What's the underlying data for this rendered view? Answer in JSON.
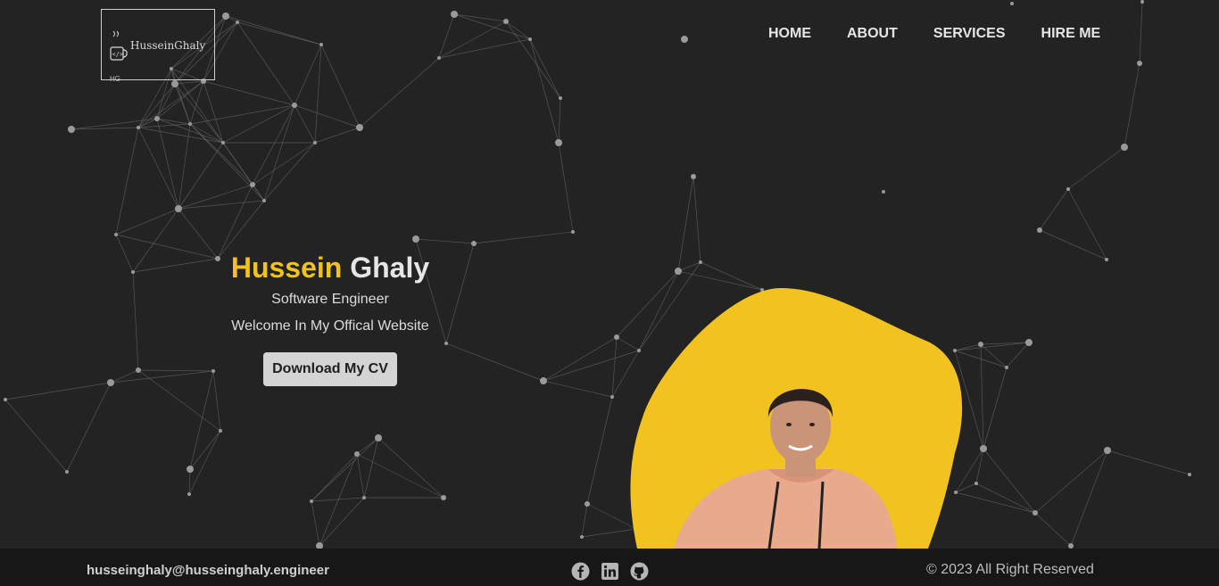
{
  "logo": {
    "text": "HusseinGhaly",
    "mini": "HG"
  },
  "nav": {
    "items": [
      "HOME",
      "ABOUT",
      "SERVICES",
      "HIRE ME"
    ]
  },
  "hero": {
    "first_name": "Hussein",
    "last_name": "Ghaly",
    "role": "Software Engineer",
    "welcome": "Welcome In My Offical Website",
    "cv_button": "Download My CV"
  },
  "footer": {
    "email": "husseinghaly@husseinghaly.engineer",
    "socials": [
      "facebook-icon",
      "linkedin-icon",
      "github-icon"
    ],
    "copyright": "© 2023 All Right Reserved"
  },
  "colors": {
    "background": "#232323",
    "accent": "#f2c21f",
    "footer": "#171717"
  }
}
